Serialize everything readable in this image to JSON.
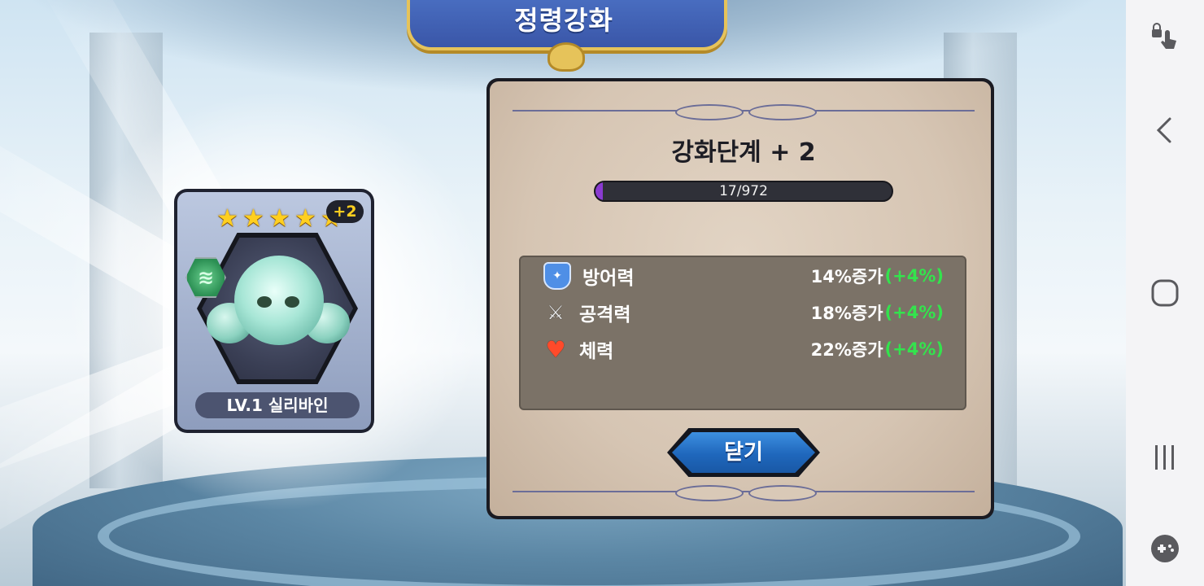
{
  "screen": {
    "title": "정령강화"
  },
  "spirit_card": {
    "star_count": 5,
    "stars": [
      "★",
      "★",
      "★",
      "★",
      "★"
    ],
    "enhance_badge": "+2",
    "element_icon": "wind-emblem-icon",
    "name": "LV.1 실리바인"
  },
  "panel": {
    "stage_title": "강화단계 + 2",
    "progress": {
      "text": "17/972",
      "current": 17,
      "max": 972,
      "fill_color": "#8a3bd1"
    },
    "stats": [
      {
        "icon": "shield-icon",
        "label": "방어력",
        "value": "14%증가",
        "delta": "(+4%)"
      },
      {
        "icon": "crossed-swords-icon",
        "label": "공격력",
        "value": "18%증가",
        "delta": "(+4%)"
      },
      {
        "icon": "heart-icon",
        "label": "체력",
        "value": "22%증가",
        "delta": "(+4%)"
      }
    ],
    "close_button": "닫기"
  },
  "nav_bar": {
    "items": [
      "touch-lock-icon",
      "back-icon",
      "home-icon",
      "recents-icon",
      "game-tools-icon"
    ]
  },
  "colors": {
    "accent_blue": "#1f67bc",
    "delta_green": "#33e34d",
    "star_gold": "#ffcf1f"
  }
}
